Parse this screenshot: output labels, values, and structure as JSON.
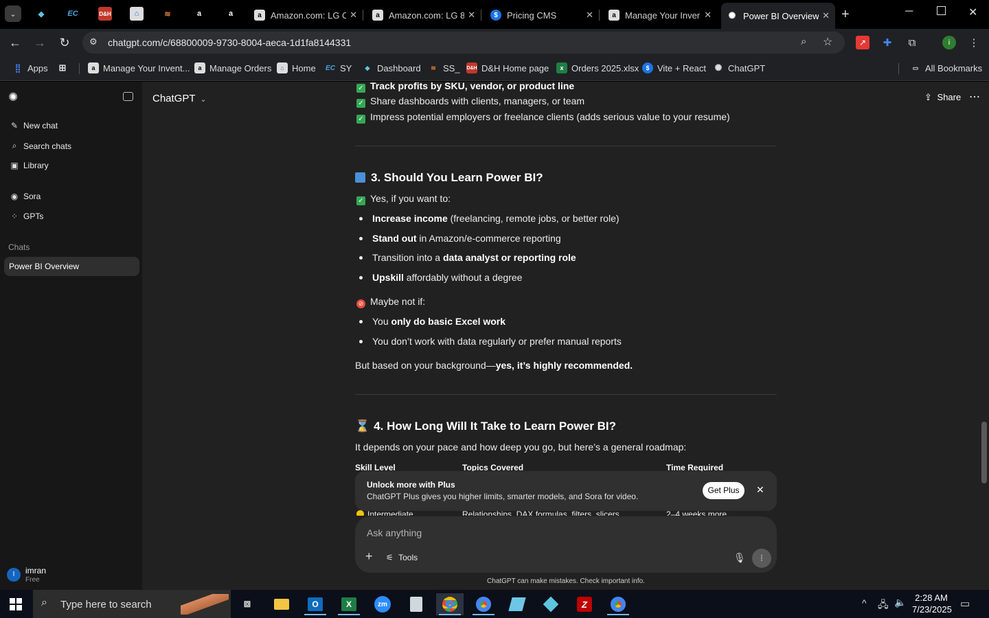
{
  "browser": {
    "tabs": [
      {
        "title": "Amazon.com: LG C",
        "icon": "amazon-icon"
      },
      {
        "title": "Amazon.com: LG 8",
        "icon": "amazon-icon"
      },
      {
        "title": "Pricing CMS",
        "icon": "dollar-icon"
      },
      {
        "title": "Manage Your Inver",
        "icon": "amazon-icon"
      },
      {
        "title": "Power BI Overview",
        "icon": "chatgpt-icon"
      }
    ],
    "url": "chatgpt.com/c/68800009-9730-8004-aeca-1d1fa8144331",
    "bookmarks": [
      {
        "label": "Apps",
        "icon": "apps-grid-icon"
      },
      {
        "label": "Manage Your Invent...",
        "icon": "amazon-icon"
      },
      {
        "label": "Manage Orders",
        "icon": "amazon-icon"
      },
      {
        "label": "Home",
        "icon": "home-icon"
      },
      {
        "label": "SY",
        "icon": "ec-icon"
      },
      {
        "label": "Dashboard",
        "icon": "dashboard-icon"
      },
      {
        "label": "SS_",
        "icon": "ss-icon"
      },
      {
        "label": "D&H Home page",
        "icon": "dh-icon"
      },
      {
        "label": "Orders 2025.xlsx",
        "icon": "excel-icon"
      },
      {
        "label": "Vite + React",
        "icon": "dollar-icon"
      },
      {
        "label": "ChatGPT",
        "icon": "chatgpt-icon"
      }
    ],
    "all_bookmarks": "All Bookmarks",
    "profile_initial": "i",
    "colors": {
      "tab_bar": "#000000",
      "toolbar": "#202124"
    }
  },
  "app": {
    "model_label": "ChatGPT",
    "share_label": "Share",
    "sidebar": {
      "items": [
        {
          "label": "New chat",
          "icon": "new-chat-icon"
        },
        {
          "label": "Search chats",
          "icon": "search-icon"
        },
        {
          "label": "Library",
          "icon": "library-icon"
        },
        {
          "label": "Sora",
          "icon": "sora-icon"
        },
        {
          "label": "GPTs",
          "icon": "gpts-icon"
        }
      ],
      "section_label": "Chats",
      "chats": [
        "Power BI Overview"
      ],
      "user": {
        "name": "imran",
        "plan": "Free",
        "initial": "I"
      }
    },
    "message": {
      "top_checks": [
        {
          "bold": "Track profits by SKU, vendor, or product line",
          "rest": ""
        },
        {
          "bold": "",
          "rest": "Share dashboards with clients, managers, or team"
        },
        {
          "bold": "",
          "rest": "Impress potential employers or freelance clients (adds serious value to your resume)"
        }
      ],
      "section3_title": "3. Should You Learn Power BI?",
      "yes_line": "Yes, if you want to:",
      "yes_bullets": [
        {
          "b1": "Increase income",
          "t1": " (freelancing, remote jobs, or better role)",
          "b2": "",
          "t2": ""
        },
        {
          "b1": "Stand out",
          "t1": " in Amazon/e-commerce reporting",
          "b2": "",
          "t2": ""
        },
        {
          "b1": "",
          "t1": "Transition into a ",
          "b2": "data analyst or reporting role",
          "t2": ""
        },
        {
          "b1": "Upskill",
          "t1": " affordably without a degree",
          "b2": "",
          "t2": ""
        }
      ],
      "maybe_line": "Maybe not if:",
      "maybe_bullets": [
        {
          "b1": "",
          "t1": "You ",
          "b2": "only do basic Excel work",
          "t2": ""
        },
        {
          "b1": "",
          "t1": "You don’t work with data regularly or prefer manual reports",
          "b2": "",
          "t2": ""
        }
      ],
      "conclusion_plain": "But based on your background—",
      "conclusion_bold": "yes, it’s highly recommended.",
      "section4_title": "4. How Long Will It Take to Learn Power BI?",
      "section4_intro": "It depends on your pace and how deep you go, but here’s a general roadmap:",
      "table_headers": [
        "Skill Level",
        "Topics Covered",
        "Time Required"
      ],
      "table_partial_row": [
        "Intermediate",
        "Relationships, DAX formulas, filters, slicers",
        "2–4 weeks more"
      ]
    },
    "banner": {
      "title": "Unlock more with Plus",
      "subtitle": "ChatGPT Plus gives you higher limits, smarter models, and Sora for video.",
      "button": "Get Plus"
    },
    "composer": {
      "placeholder": "Ask anything",
      "tools_label": "Tools",
      "disclaimer": "ChatGPT can make mistakes. Check important info."
    },
    "colors": {
      "sidebar": "#171717",
      "main": "#212121",
      "check_green": "#34a853"
    }
  },
  "taskbar": {
    "search_placeholder": "Type here to search",
    "time": "2:28 AM",
    "date": "7/23/2025"
  }
}
